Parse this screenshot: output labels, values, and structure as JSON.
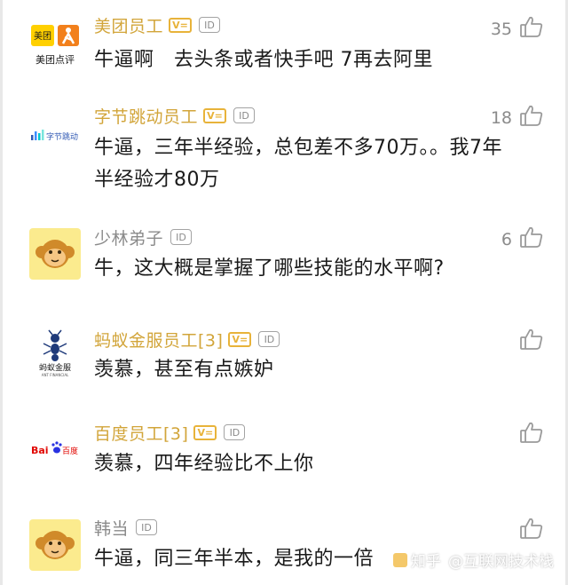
{
  "comments": [
    {
      "author": "美团员工",
      "avatar_text": [
        "美团",
        "美团点评"
      ],
      "has_v_badge": true,
      "has_id_badge": true,
      "likes": "35",
      "text": "牛逼啊　去头条或者快手吧 7再去阿里"
    },
    {
      "author": "字节跳动员工",
      "avatar_text": [
        "字节跳动"
      ],
      "has_v_badge": true,
      "has_id_badge": true,
      "likes": "18",
      "text": "牛逼，三年半经验，总包差不多70万。。我7年半经验才80万"
    },
    {
      "author": "少林弟子",
      "avatar_text": [],
      "has_v_badge": false,
      "has_id_badge": true,
      "likes": "6",
      "text": "牛，这大概是掌握了哪些技能的水平啊?"
    },
    {
      "author": "蚂蚁金服员工[3]",
      "avatar_text": [
        "蚂蚁金服",
        "ANT FINANCIAL"
      ],
      "has_v_badge": true,
      "has_id_badge": true,
      "likes": "",
      "text": "羡慕，甚至有点嫉妒"
    },
    {
      "author": "百度员工[3]",
      "avatar_text": [
        "Bai",
        "百度"
      ],
      "has_v_badge": true,
      "has_id_badge": true,
      "likes": "",
      "text": "羡慕，四年经验比不上你"
    },
    {
      "author": "韩当",
      "avatar_text": [],
      "has_v_badge": false,
      "has_id_badge": true,
      "likes": "",
      "text": "牛逼，同三年半本，是我的一倍"
    }
  ],
  "badges": {
    "id_label": "ID",
    "v_label": "V="
  },
  "watermark": {
    "zh": "知乎",
    "handle": "@互联网技术栈"
  },
  "colors": {
    "author_gold": "#d2a53a",
    "meituan_yellow": "#ffd000",
    "meituan_orange": "#f2801c",
    "baidu_blue": "#2932e1",
    "baidu_red": "#e10601",
    "monkey_bg": "#fbeb8e"
  },
  "icons": {
    "like": "thumbs-up-outline-icon"
  }
}
